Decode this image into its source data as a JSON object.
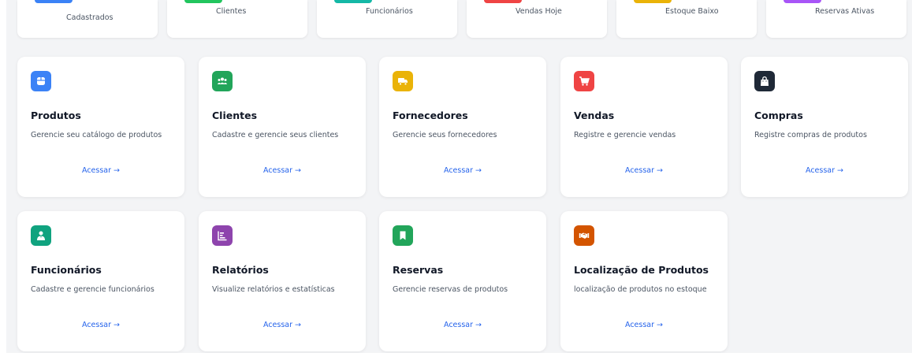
{
  "stats": [
    {
      "label": "Cadastrados",
      "color": "#3b82f6"
    },
    {
      "label": "Clientes",
      "color": "#22c55e"
    },
    {
      "label": "Funcionários",
      "color": "#14b8a6"
    },
    {
      "label": "Vendas Hoje",
      "color": "#ef4444"
    },
    {
      "label": "Estoque Baixo",
      "color": "#eab308"
    },
    {
      "label": "Reservas Ativas",
      "color": "#a855f7"
    }
  ],
  "modules": [
    {
      "title": "Produtos",
      "desc": "Gerencie seu catálogo de produtos",
      "link": "Acessar →",
      "color": "#3b82f6",
      "icon": "box-icon"
    },
    {
      "title": "Clientes",
      "desc": "Cadastre e gerencie seus clientes",
      "link": "Acessar →",
      "color": "#22a55a",
      "icon": "users-icon"
    },
    {
      "title": "Fornecedores",
      "desc": "Gerencie seus fornecedores",
      "link": "Acessar →",
      "color": "#eab308",
      "icon": "truck-icon"
    },
    {
      "title": "Vendas",
      "desc": "Registre e gerencie vendas",
      "link": "Acessar →",
      "color": "#ef4444",
      "icon": "cart-icon"
    },
    {
      "title": "Compras",
      "desc": "Registre compras de produtos",
      "link": "Acessar →",
      "color": "#1f2937",
      "icon": "bag-icon"
    },
    {
      "title": "Funcionários",
      "desc": "Cadastre e gerencie funcionários",
      "link": "Acessar →",
      "color": "#10a37f",
      "icon": "employee-icon"
    },
    {
      "title": "Relatórios",
      "desc": "Visualize relatórios e estatísticas",
      "link": "Acessar →",
      "color": "#8e44ad",
      "icon": "report-icon"
    },
    {
      "title": "Reservas",
      "desc": "Gerencie reservas de produtos",
      "link": "Acessar →",
      "color": "#22a55a",
      "icon": "bookmark-icon"
    },
    {
      "title": "Localização de Produtos",
      "desc": "localização de produtos no estoque",
      "link": "Acessar →",
      "color": "#d35400",
      "icon": "handshake-icon"
    }
  ]
}
